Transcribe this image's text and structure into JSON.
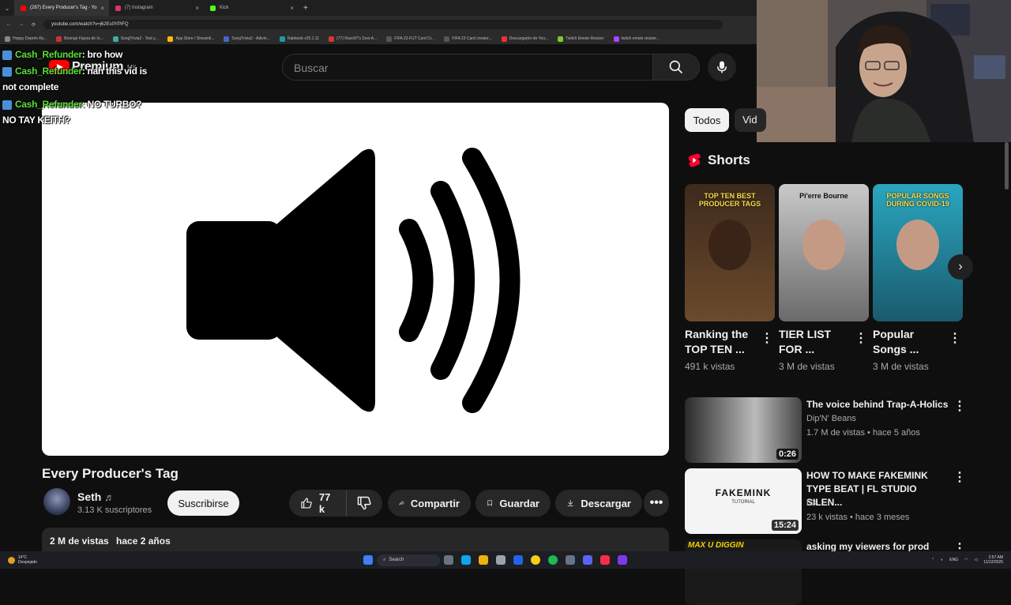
{
  "browser": {
    "tabs": [
      {
        "label": "(287) Every Producer's Tag - Yo",
        "color": "#ff0000",
        "active": true
      },
      {
        "label": "(7) Instagram",
        "color": "#e1306c",
        "active": false
      },
      {
        "label": "Kick",
        "color": "#53fc18",
        "active": false
      }
    ],
    "url": "youtube.com/watch?v=j62Es0YPiFQ",
    "bookmarks": [
      "Hoppy Deprim Ry...",
      "Bonnge Figura de Io...",
      "SongTrivia2 - Test y...",
      "App Store / Streamli...",
      "SongTrivia2 - Adivin...",
      "Raletoob v25.1.11",
      "(77) Razo97's Zest-A...",
      "FIFA 23 FUT Card Cr...",
      "FIFA 23 Card creator...",
      "Descargador de You...",
      "Twitch Emote Resizer",
      "twitch emote resizer..."
    ]
  },
  "youtube": {
    "logo_text": "Premium",
    "logo_region": "MX",
    "search_placeholder": "Buscar"
  },
  "chat": [
    {
      "user": "Cash_Refunder",
      "message": ": bro how"
    },
    {
      "user": "Cash_Refunder",
      "message": ": nah this vid is",
      "continuation": "not complete"
    },
    {
      "user": "Cash_Refunder",
      "message": ": NO TURBO?",
      "continuation": "NO TAY KEITH?"
    }
  ],
  "video": {
    "title": "Every Producer's Tag",
    "channel": "Seth",
    "channel_badge": "♬",
    "subscribers": "3.13 K suscriptores",
    "subscribe_label": "Suscribirse",
    "likes": "77 k",
    "share_label": "Compartir",
    "save_label": "Guardar",
    "download_label": "Descargar",
    "views": "2 M de vistas",
    "age": "hace 2 años"
  },
  "sidebar": {
    "chips": [
      "Todos",
      "Vid"
    ],
    "shorts_heading": "Shorts",
    "shorts": [
      {
        "title": "Ranking the TOP TEN ...",
        "views": "491 k vistas",
        "overlay": "TOP TEN BEST PRODUCER TAGS",
        "colors": [
          "#3d2a1c",
          "#6b4a2c"
        ]
      },
      {
        "title": "TIER LIST FOR ...",
        "views": "3 M de vistas",
        "overlay": "Pi'erre Bourne",
        "colors": [
          "#c9c9c9",
          "#6a6a6a"
        ]
      },
      {
        "title": "Popular Songs ...",
        "views": "3 M de vistas",
        "overlay": "POPULAR SONGS DURING COVID-19",
        "colors": [
          "#2aa6c0",
          "#1a5a6d"
        ]
      }
    ],
    "videos": [
      {
        "title": "The voice behind Trap-A-Holics",
        "channel": "Dip'N' Beans",
        "meta": "1.7 M de vistas • hace 5 años",
        "duration": "0:26"
      },
      {
        "title": "HOW TO MAKE FAKEMINK TYPE BEAT | FL STUDIO SILEN...",
        "channel": "h3",
        "meta": "23 k vistas • hace 3 meses",
        "duration": "15:24",
        "thumb_text": "FAKEMINK",
        "thumb_sub": "TUTORIAL"
      },
      {
        "title": "asking my viewers for prod tags",
        "thumb_text": "MAX U DIGGIN"
      }
    ]
  },
  "taskbar": {
    "weather_temp": "14°C",
    "weather_desc": "Despejado",
    "search_label": "Search",
    "lang": "ENG",
    "time": "2:57 AM",
    "date": "11/12/2025"
  }
}
